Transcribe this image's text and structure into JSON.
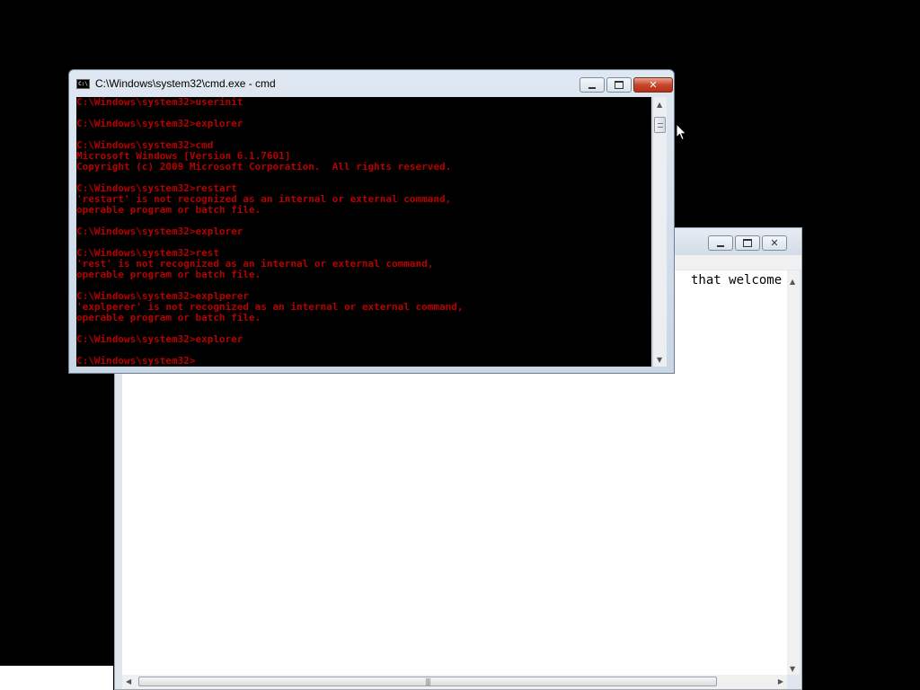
{
  "cmd_window": {
    "title": "C:\\Windows\\system32\\cmd.exe - cmd",
    "icon": "console-icon",
    "text_color": "#b80000",
    "lines": [
      "C:\\Windows\\system32>userinit",
      "",
      "C:\\Windows\\system32>explorer",
      "",
      "C:\\Windows\\system32>cmd",
      "Microsoft Windows [Version 6.1.7601]",
      "Copyright (c) 2009 Microsoft Corporation.  All rights reserved.",
      "",
      "C:\\Windows\\system32>restart",
      "'restart' is not recognized as an internal or external command,",
      "operable program or batch file.",
      "",
      "C:\\Windows\\system32>explorer",
      "",
      "C:\\Windows\\system32>rest",
      "'rest' is not recognized as an internal or external command,",
      "operable program or batch file.",
      "",
      "C:\\Windows\\system32>explperer",
      "'explperer' is not recognized as an internal or external command,",
      "operable program or batch file.",
      "",
      "C:\\Windows\\system32>explorer",
      "",
      "C:\\Windows\\system32>"
    ]
  },
  "background_window": {
    "visible_text": "that welcome"
  }
}
